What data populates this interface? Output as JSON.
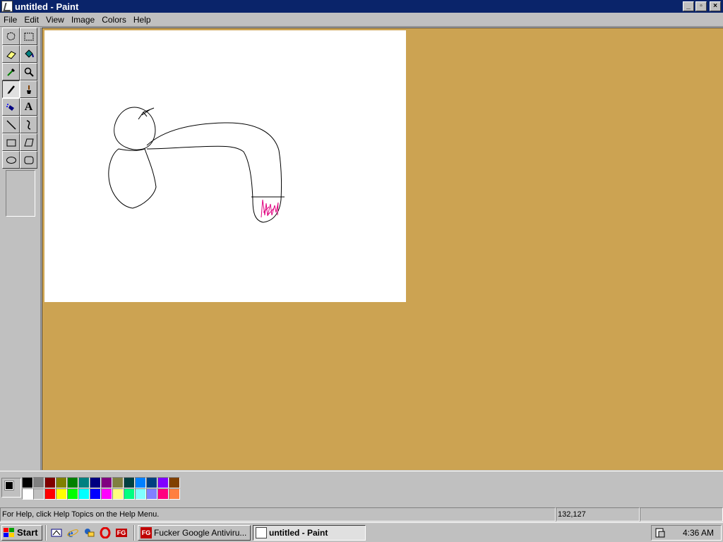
{
  "window": {
    "title": "untitled - Paint",
    "buttons": {
      "minimize": "_",
      "maximize": "▫",
      "close": "×"
    }
  },
  "menu": {
    "items": [
      {
        "label": "File"
      },
      {
        "label": "Edit"
      },
      {
        "label": "View"
      },
      {
        "label": "Image"
      },
      {
        "label": "Colors"
      },
      {
        "label": "Help"
      }
    ]
  },
  "toolbox": {
    "tools": [
      {
        "name": "free-form-select",
        "icon": "free-form-select-icon",
        "active": false
      },
      {
        "name": "select",
        "icon": "rect-select-icon",
        "active": false
      },
      {
        "name": "eraser",
        "icon": "eraser-icon",
        "active": false
      },
      {
        "name": "fill-with-color",
        "icon": "paint-bucket-icon",
        "active": false
      },
      {
        "name": "pick-color",
        "icon": "eyedropper-icon",
        "active": false
      },
      {
        "name": "magnifier",
        "icon": "magnifier-icon",
        "active": false
      },
      {
        "name": "pencil",
        "icon": "pencil-icon",
        "active": true
      },
      {
        "name": "brush",
        "icon": "brush-icon",
        "active": false
      },
      {
        "name": "airbrush",
        "icon": "airbrush-icon",
        "active": false
      },
      {
        "name": "text",
        "icon": "text-icon",
        "active": false
      },
      {
        "name": "line",
        "icon": "line-icon",
        "active": false
      },
      {
        "name": "curve",
        "icon": "curve-icon",
        "active": false
      },
      {
        "name": "rectangle",
        "icon": "rectangle-icon",
        "active": false
      },
      {
        "name": "polygon",
        "icon": "polygon-icon",
        "active": false
      },
      {
        "name": "ellipse",
        "icon": "ellipse-icon",
        "active": false
      },
      {
        "name": "rounded-rectangle",
        "icon": "rounded-rectangle-icon",
        "active": false
      }
    ],
    "text_tool_glyph": "A"
  },
  "colors": {
    "workspace_bg": "#cca352",
    "foreground": "#000000",
    "background": "#ffffff",
    "palette_top": [
      "#000000",
      "#808080",
      "#800000",
      "#808000",
      "#008000",
      "#008080",
      "#000080",
      "#800080",
      "#808040",
      "#004040",
      "#0080ff",
      "#004080",
      "#8000ff",
      "#804000"
    ],
    "palette_bottom": [
      "#ffffff",
      "#c0c0c0",
      "#ff0000",
      "#ffff00",
      "#00ff00",
      "#00ffff",
      "#0000ff",
      "#ff00ff",
      "#ffff80",
      "#00ff80",
      "#80ffff",
      "#8080ff",
      "#ff0080",
      "#ff8040"
    ]
  },
  "status": {
    "help_text": "For Help, click Help Topics on the Help Menu.",
    "coordinates": "132,127",
    "size": ""
  },
  "taskbar": {
    "start_label": "Start",
    "quick_launch": [
      {
        "icon": "show-desktop-icon"
      },
      {
        "icon": "internet-explorer-icon"
      },
      {
        "icon": "outlook-express-icon"
      },
      {
        "icon": "opera-icon"
      },
      {
        "icon": "fg-icon",
        "text": "FG"
      }
    ],
    "tasks": [
      {
        "label": "Fucker Google Antiviru...",
        "icon_text": "FG",
        "active": false
      },
      {
        "label": "untitled - Paint",
        "active": true
      }
    ],
    "clock": "4:36 AM"
  }
}
